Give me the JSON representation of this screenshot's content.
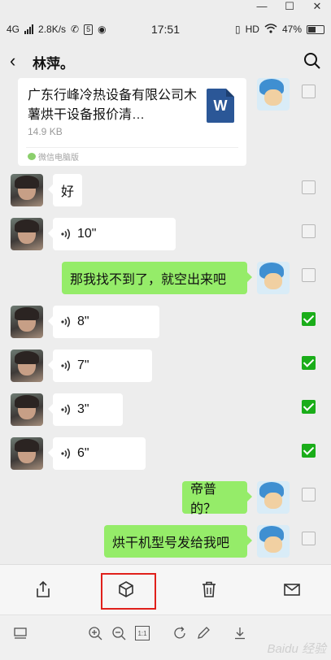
{
  "status_bar": {
    "network": "4G",
    "speed": "2.8K/s",
    "time": "17:51",
    "hd": "HD",
    "battery": "47%"
  },
  "window_controls": {
    "minimize": "—",
    "maximize": "☐",
    "close": "✕"
  },
  "header": {
    "back": "‹",
    "title": "林萍。"
  },
  "file": {
    "title": "广东行峰冷热设备有限公司木薯烘干设备报价清…",
    "size": "14.9 KB",
    "source": "微信电脑版",
    "icon_letter": "W",
    "checked": false
  },
  "messages": [
    {
      "id": "m1",
      "sender": "other",
      "type": "text",
      "text": "好",
      "checked": false
    },
    {
      "id": "m2",
      "sender": "other",
      "type": "voice",
      "text": "10\"",
      "checked": false
    },
    {
      "id": "m3",
      "sender": "me",
      "type": "text",
      "text": "那我找不到了，就空出来吧",
      "checked": false
    },
    {
      "id": "m4",
      "sender": "other",
      "type": "voice",
      "text": "8\"",
      "checked": true
    },
    {
      "id": "m5",
      "sender": "other",
      "type": "voice",
      "text": "7\"",
      "checked": true
    },
    {
      "id": "m6",
      "sender": "other",
      "type": "voice",
      "text": "3\"",
      "checked": true
    },
    {
      "id": "m7",
      "sender": "other",
      "type": "voice",
      "text": "6\"",
      "checked": true
    },
    {
      "id": "m8",
      "sender": "me",
      "type": "text",
      "text": "帝普的？",
      "checked": false
    },
    {
      "id": "m9",
      "sender": "me",
      "type": "text",
      "text": "烘干机型号发给我吧",
      "checked": false
    }
  ],
  "actions": [
    "share-icon",
    "favorite-box-icon",
    "delete-icon",
    "mail-icon"
  ],
  "toolbar": {
    "fit_label": "1:1"
  },
  "watermark": "Baidu 经验",
  "colors": {
    "my_bubble": "#95ec69",
    "check_on": "#1aad19",
    "highlight": "#e0201b"
  }
}
